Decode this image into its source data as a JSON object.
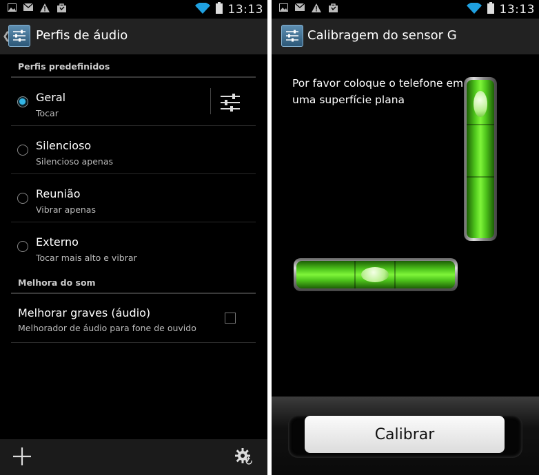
{
  "left": {
    "status_time": "13:13",
    "title": "Perfis de áudio",
    "sections": [
      {
        "header": "Perfis predefinidos"
      },
      {
        "header": "Melhora do som"
      }
    ],
    "profiles": [
      {
        "title": "Geral",
        "subtitle": "Tocar",
        "selected": true
      },
      {
        "title": "Silencioso",
        "subtitle": "Silencioso apenas",
        "selected": false
      },
      {
        "title": "Reunião",
        "subtitle": "Vibrar apenas",
        "selected": false
      },
      {
        "title": "Externo",
        "subtitle": "Tocar mais alto e vibrar",
        "selected": false
      }
    ],
    "bass": {
      "title": "Melhorar graves (áudio)",
      "subtitle": "Melhorador de áudio para fone de ouvido",
      "checked": false
    },
    "icons": {
      "add": "plus-icon",
      "settings": "gear-reset-icon",
      "equalizer": "sliders-icon"
    }
  },
  "right": {
    "status_time": "13:13",
    "title": "Calibragem do sensor G",
    "instruction": "Por favor coloque o telefone em uma superfície plana",
    "button_label": "Calibrar"
  },
  "colors": {
    "accent": "#33b5e5",
    "level_green": "#4ec51c"
  }
}
